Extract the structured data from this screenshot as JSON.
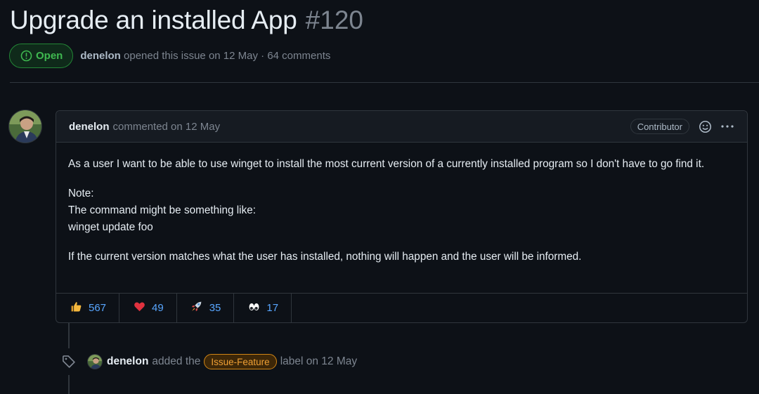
{
  "issue": {
    "title": "Upgrade an installed App",
    "number": "#120",
    "state": "Open",
    "author": "denelon",
    "opened_text": "opened this issue on 12 May · 64 comments"
  },
  "comment": {
    "author": "denelon",
    "when": "commented on 12 May",
    "role": "Contributor",
    "paragraphs": {
      "p1": "As a user I want to be able to use winget to install the most current version of a currently installed program so I don't have to go find it.",
      "note_line1": "Note:",
      "note_line2": "The command might be something like:",
      "note_line3": "winget update foo",
      "p3": "If the current version matches what the user has installed, nothing will happen and the user will be informed."
    },
    "reactions": [
      {
        "icon": "thumbs-up-icon",
        "glyph": "👍",
        "count": "567"
      },
      {
        "icon": "heart-icon",
        "glyph": "❤",
        "count": "49"
      },
      {
        "icon": "rocket-icon",
        "glyph": "🚀",
        "count": "35"
      },
      {
        "icon": "eyes-icon",
        "glyph": "👀",
        "count": "17"
      }
    ]
  },
  "event": {
    "author": "denelon",
    "action": "added the",
    "label": "Issue-Feature",
    "suffix": "label on 12 May"
  },
  "colors": {
    "background": "#0d1117",
    "open_green": "#3fb950",
    "link_blue": "#58a6ff",
    "label_orange": "#f0a035"
  }
}
